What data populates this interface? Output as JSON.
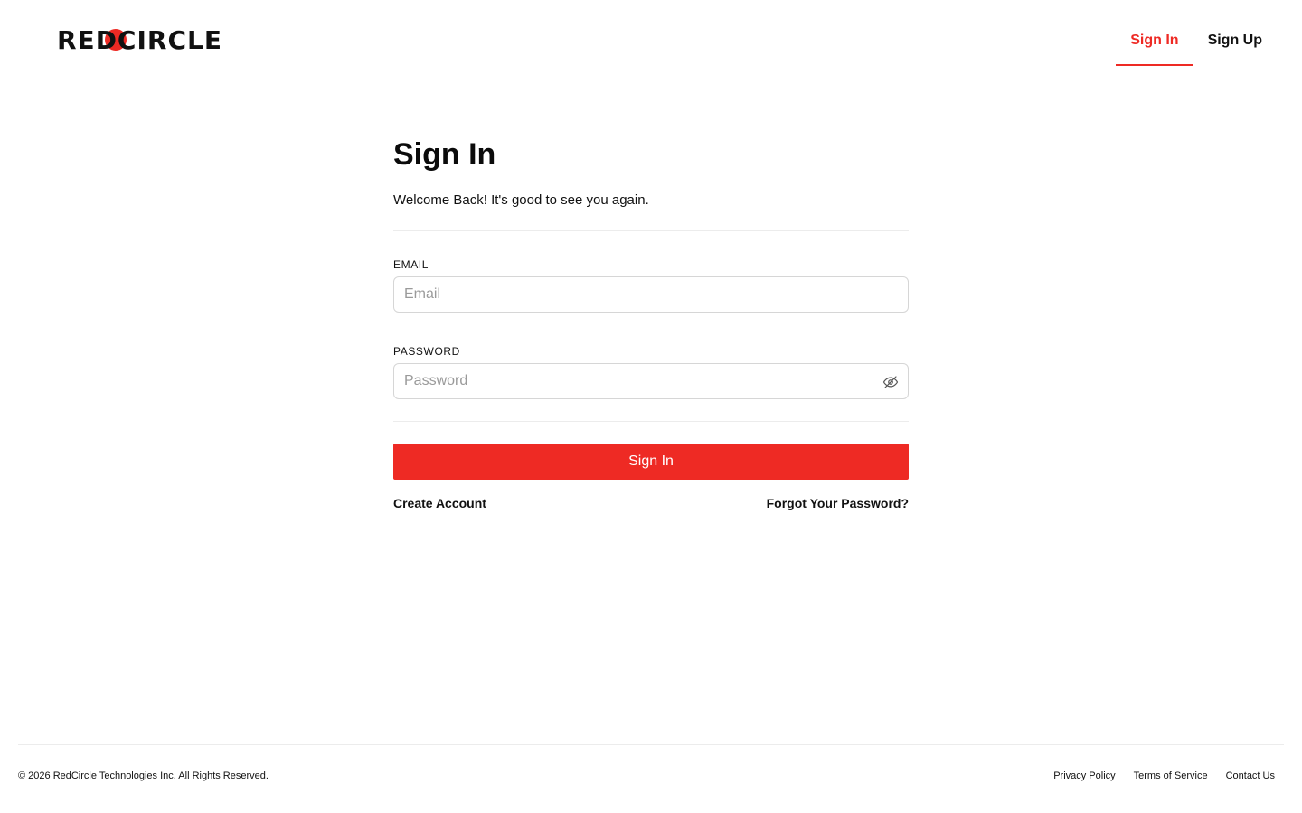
{
  "header": {
    "logo_text": "REDCIRCLE",
    "nav": {
      "sign_in": "Sign In",
      "sign_up": "Sign Up"
    }
  },
  "main": {
    "title": "Sign In",
    "subtitle": "Welcome Back! It's good to see you again.",
    "email": {
      "label": "EMAIL",
      "placeholder": "Email",
      "value": ""
    },
    "password": {
      "label": "PASSWORD",
      "placeholder": "Password",
      "value": "",
      "toggle_icon": "eye-off-icon"
    },
    "submit_label": "Sign In",
    "create_account": "Create Account",
    "forgot_password": "Forgot Your Password?"
  },
  "footer": {
    "copyright": "© 2026 RedCircle Technologies Inc. All Rights Reserved.",
    "links": {
      "privacy": "Privacy Policy",
      "terms": "Terms of Service",
      "contact": "Contact Us"
    }
  },
  "colors": {
    "brand": "#ee2a24",
    "text": "#111111",
    "border": "#d6d6d6"
  }
}
